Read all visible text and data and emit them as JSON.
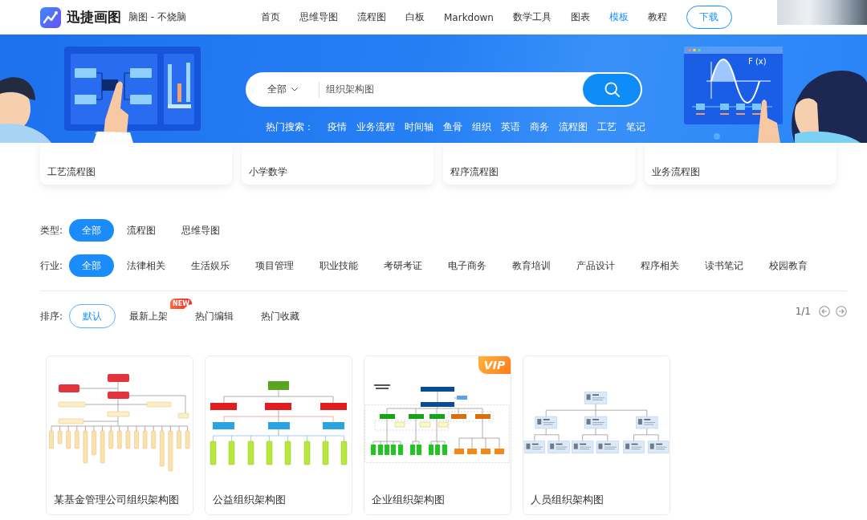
{
  "header": {
    "brand": "迅捷画图",
    "slogan": "脑图 - 不烧脑",
    "nav": [
      {
        "label": "首页",
        "selected": false
      },
      {
        "label": "思维导图",
        "selected": false
      },
      {
        "label": "流程图",
        "selected": false
      },
      {
        "label": "白板",
        "selected": false
      },
      {
        "label": "Markdown",
        "selected": false
      },
      {
        "label": "数学工具",
        "selected": false
      },
      {
        "label": "图表",
        "selected": false
      },
      {
        "label": "模板",
        "selected": true
      },
      {
        "label": "教程",
        "selected": false
      }
    ],
    "download_button": "下载"
  },
  "banner": {
    "illustration_label": "F (x)",
    "search": {
      "scope": "全部",
      "value": "组织架构图"
    },
    "hot_search": {
      "label": "热门搜索：",
      "terms": [
        "疫情",
        "业务流程",
        "时间轴",
        "鱼骨",
        "组织",
        "英语",
        "商务",
        "流程图",
        "工艺",
        "笔记"
      ]
    }
  },
  "featured": [
    "工艺流程图",
    "小学数学",
    "程序流程图",
    "业务流程图"
  ],
  "filters": [
    {
      "label": "类型:",
      "options": [
        {
          "label": "全部",
          "selected": true
        },
        {
          "label": "流程图",
          "selected": false
        },
        {
          "label": "思维导图",
          "selected": false
        }
      ]
    },
    {
      "label": "行业:",
      "options": [
        {
          "label": "全部",
          "selected": true
        },
        {
          "label": "法律相关",
          "selected": false
        },
        {
          "label": "生活娱乐",
          "selected": false
        },
        {
          "label": "项目管理",
          "selected": false
        },
        {
          "label": "职业技能",
          "selected": false
        },
        {
          "label": "考研考证",
          "selected": false
        },
        {
          "label": "电子商务",
          "selected": false
        },
        {
          "label": "教育培训",
          "selected": false
        },
        {
          "label": "产品设计",
          "selected": false
        },
        {
          "label": "程序相关",
          "selected": false
        },
        {
          "label": "读书笔记",
          "selected": false
        },
        {
          "label": "校园教育",
          "selected": false
        }
      ]
    }
  ],
  "sort": {
    "label": "排序:",
    "options": [
      {
        "label": "默认",
        "selected": true
      },
      {
        "label": "最新上架",
        "selected": false,
        "badge": "NEW"
      },
      {
        "label": "热门编辑",
        "selected": false
      },
      {
        "label": "热门收藏",
        "selected": false
      }
    ],
    "page": "1/1"
  },
  "templates": [
    {
      "title": "某基金管理公司组织架构图",
      "kind": "vertical"
    },
    {
      "title": "公益组织架构图",
      "kind": "tiered"
    },
    {
      "title": "企业组织架构图",
      "kind": "sectioned",
      "badge": "VIP"
    },
    {
      "title": "人员组织架构图",
      "kind": "profile"
    }
  ]
}
